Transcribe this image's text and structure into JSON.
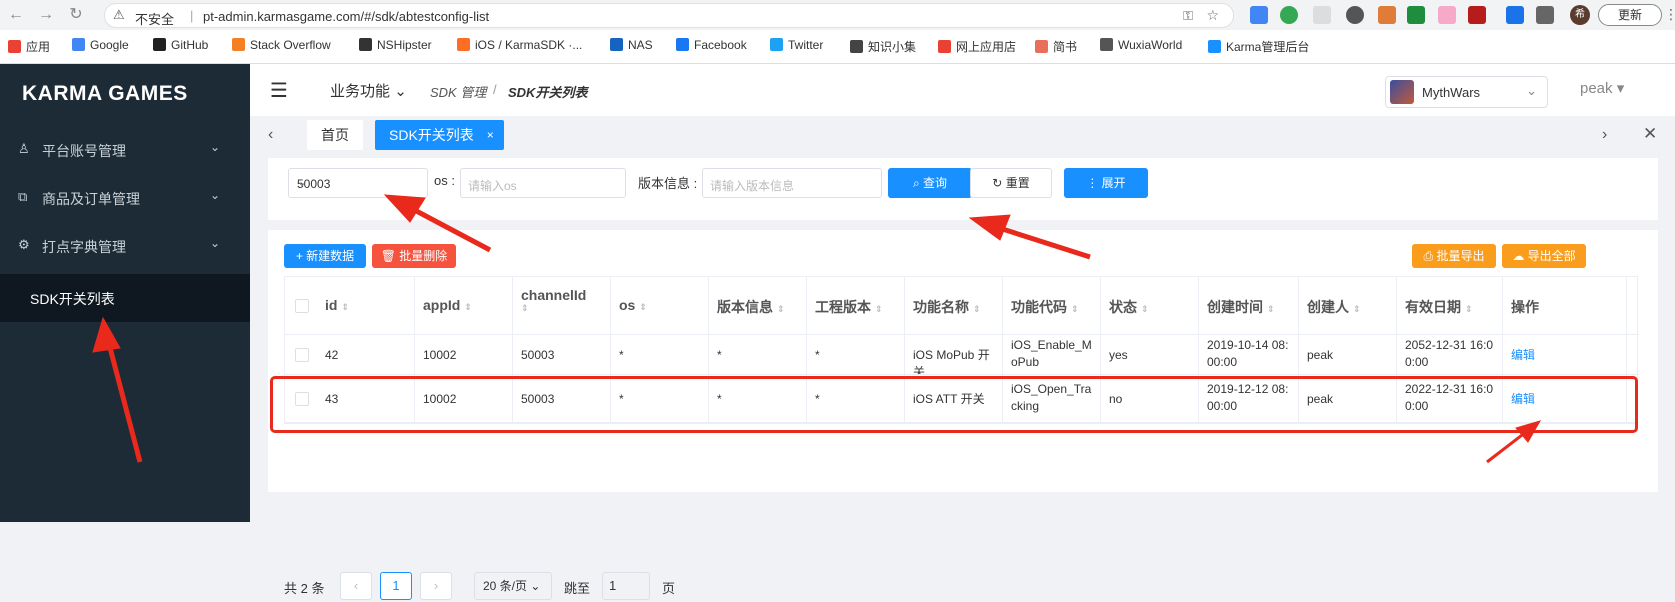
{
  "browser": {
    "insecure_label": "不安全",
    "url": "pt-admin.karmasgame.com/#/sdk/abtestconfig-list",
    "update_label": "更新",
    "avatar_text": "希",
    "bookmarks": [
      {
        "label": "应用",
        "color": "#e94235"
      },
      {
        "label": "Google",
        "color": "#4285f4"
      },
      {
        "label": "GitHub",
        "color": "#222222"
      },
      {
        "label": "Stack Overflow",
        "color": "#f48024"
      },
      {
        "label": "NSHipster",
        "color": "#333333"
      },
      {
        "label": "iOS / KarmaSDK ·...",
        "color": "#fc6d26"
      },
      {
        "label": "NAS",
        "color": "#1565c0"
      },
      {
        "label": "Facebook",
        "color": "#1877f2"
      },
      {
        "label": "Twitter",
        "color": "#1da1f2"
      },
      {
        "label": "知识小集",
        "color": "#444444"
      },
      {
        "label": "网上应用店",
        "color": "#e94235"
      },
      {
        "label": "简书",
        "color": "#ea6f5a"
      },
      {
        "label": "WuxiaWorld",
        "color": "#555555"
      },
      {
        "label": "Karma管理后台",
        "color": "#1890ff"
      }
    ]
  },
  "sidebar": {
    "logo": "KARMA GAMES",
    "items": [
      {
        "label": "平台账号管理"
      },
      {
        "label": "商品及订单管理"
      },
      {
        "label": "打点字典管理"
      }
    ],
    "active_sub": "SDK开关列表"
  },
  "header": {
    "biz_menu": "业务功能",
    "breadcrumb": [
      "SDK 管理",
      "SDK开关列表"
    ],
    "game": "MythWars",
    "user": "peak"
  },
  "tabs": {
    "home": "首页",
    "active": "SDK开关列表"
  },
  "filter": {
    "channel_value": "50003",
    "os_label": "os :",
    "os_placeholder": "请输入os",
    "version_label": "版本信息 :",
    "version_placeholder": "请输入版本信息",
    "query": "查询",
    "reset": "重置",
    "expand": "展开"
  },
  "toolbar": {
    "new": "新建数据",
    "batch_delete": "批量删除",
    "batch_export": "批量导出",
    "export_all": "导出全部"
  },
  "table": {
    "columns": [
      "id",
      "appId",
      "channelId",
      "os",
      "版本信息",
      "工程版本",
      "功能名称",
      "功能代码",
      "状态",
      "创建时间",
      "创建人",
      "有效日期",
      "操作"
    ],
    "rows": [
      [
        "42",
        "10002",
        "50003",
        "*",
        "*",
        "*",
        "iOS MoPub 开关",
        "iOS_Enable_MoPub",
        "yes",
        "2019-10-14 08:00:00",
        "peak",
        "2052-12-31 16:00:00",
        "编辑"
      ],
      [
        "43",
        "10002",
        "50003",
        "*",
        "*",
        "*",
        "iOS ATT 开关",
        "iOS_Open_Tracking",
        "no",
        "2019-12-12 08:00:00",
        "peak",
        "2022-12-31 16:00:00",
        "编辑"
      ]
    ]
  },
  "pager": {
    "total": "共 2 条",
    "current": "1",
    "page_size": "20 条/页",
    "jump": "跳至",
    "jump_value": "1",
    "page_suffix": "页"
  },
  "colors": {
    "primary": "#1890ff",
    "danger": "#f5533d",
    "warning": "#fa9d1c",
    "sidebar": "#1d2b36",
    "annotation": "#e8291c"
  }
}
